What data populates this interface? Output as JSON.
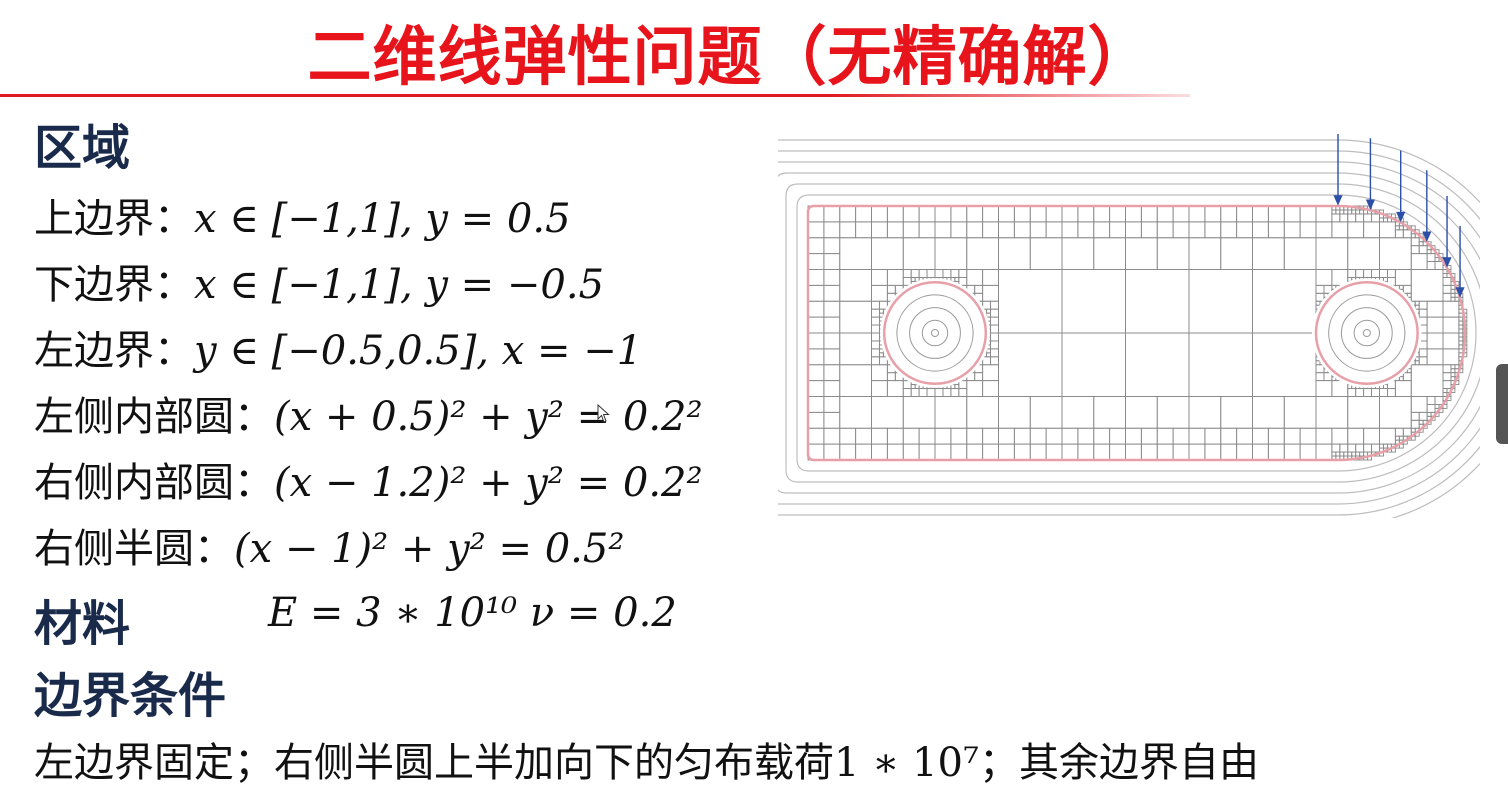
{
  "title": "二维线弹性问题（无精确解）",
  "domain_section": {
    "heading": "区域",
    "items": [
      {
        "label": "上边界：",
        "expr": "x ∈ [−1,1], y = 0.5"
      },
      {
        "label": "下边界：",
        "expr": "x ∈ [−1,1], y = −0.5"
      },
      {
        "label": "左边界：",
        "expr": "y ∈ [−0.5,0.5], x = −1"
      },
      {
        "label": "左侧内部圆：",
        "expr": "(x + 0.5)² + y² = 0.2²"
      },
      {
        "label": "右侧内部圆：",
        "expr": "(x − 1.2)² + y² = 0.2²"
      },
      {
        "label": "右侧半圆：",
        "expr": "(x − 1)² + y² = 0.5²"
      }
    ]
  },
  "material_section": {
    "heading": "材料",
    "expr": "E = 3 ∗ 10¹⁰   ν = 0.2"
  },
  "bc_section": {
    "heading": "边界条件",
    "text_before": "左边界固定；右侧半圆上半加向下的匀布载荷",
    "load": "1 ∗ 10⁷",
    "text_after": "；其余边界自由"
  },
  "colors": {
    "title": "#e8141c",
    "heading": "#1a2a4a",
    "mesh": "#8a8a8a",
    "boundary": "#e8a0a8",
    "arrow": "#2c4fa8"
  },
  "icons": [
    "mouse-cursor-icon",
    "down-arrow-icon"
  ]
}
